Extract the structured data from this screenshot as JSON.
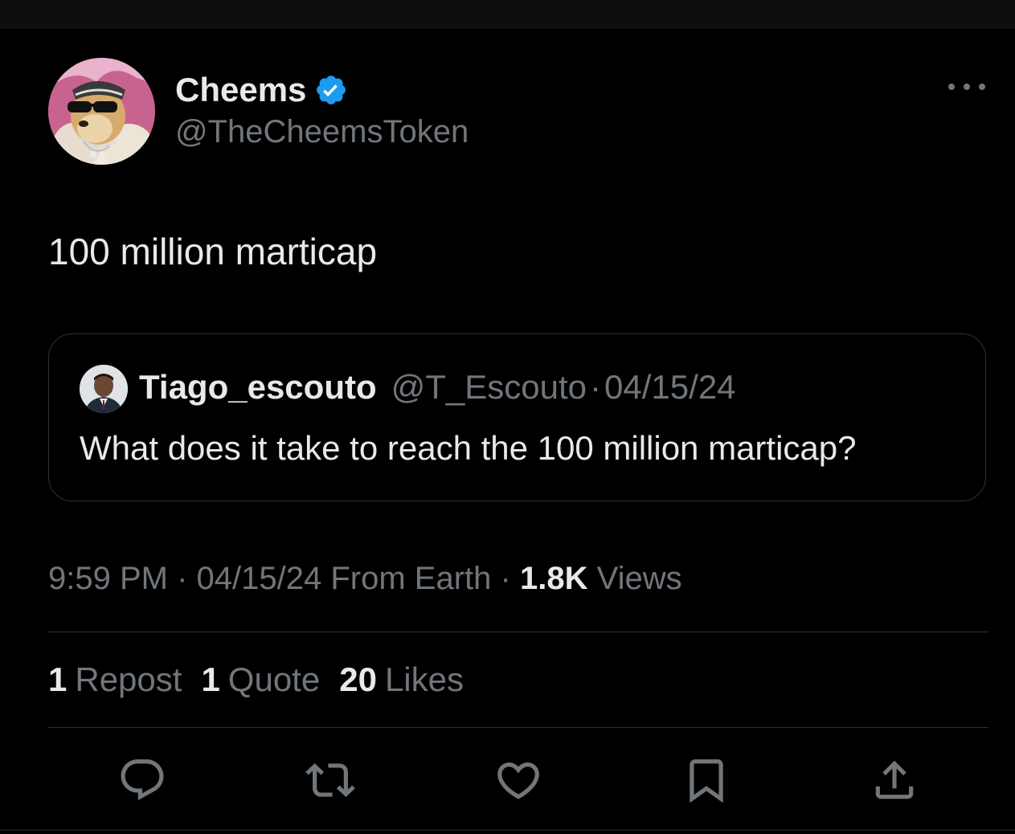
{
  "author": {
    "display_name": "Cheems",
    "handle": "@TheCheemsToken",
    "verified": true,
    "avatar": "cheems-dog-avatar"
  },
  "tweet": {
    "text": "100 million marticap"
  },
  "quoted_tweet": {
    "display_name": "Tiago_escouto",
    "handle": "@T_Escouto",
    "separator": "·",
    "date": "04/15/24",
    "text": "What does it take to reach the 100 million marticap?",
    "avatar": "person-avatar"
  },
  "meta": {
    "time": "9:59 PM",
    "separator": "·",
    "date": "04/15/24",
    "source": "From Earth",
    "views_count": "1.8K",
    "views_label": "Views"
  },
  "stats": {
    "reposts_count": "1",
    "reposts_label": "Repost",
    "quotes_count": "1",
    "quotes_label": "Quote",
    "likes_count": "20",
    "likes_label": "Likes"
  },
  "actions": {
    "reply": "reply-icon",
    "repost": "repost-icon",
    "like": "heart-icon",
    "bookmark": "bookmark-icon",
    "share": "share-icon"
  },
  "colors": {
    "background": "#000000",
    "primary_text": "#e7e9ea",
    "secondary_text": "#71767b",
    "border": "#2f3336",
    "verified_blue": "#1d9bf0"
  }
}
